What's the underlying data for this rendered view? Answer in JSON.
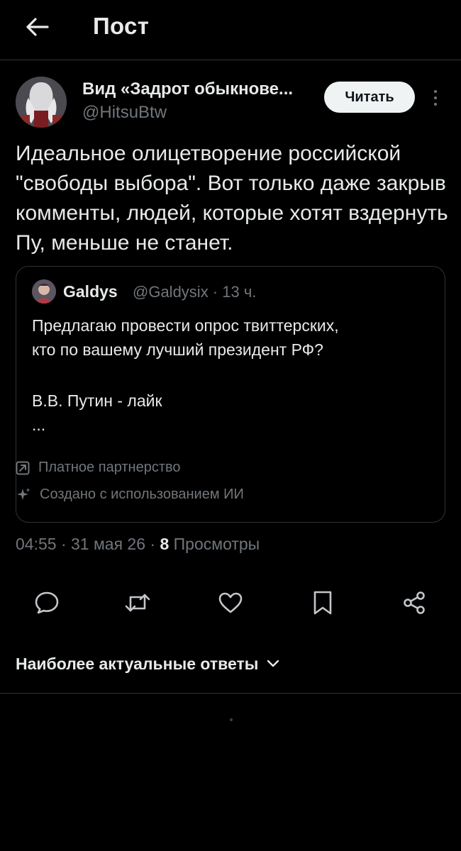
{
  "header": {
    "title": "Пост",
    "back_icon": "arrow-left-icon"
  },
  "post": {
    "author_name": "Вид «Задрот обыкнове...",
    "author_handle": "@HitsuBtw",
    "follow_label": "Читать",
    "text": "Идеальное олицетворение российской \"свободы выбора\". Вот только даже закрыв комменты, людей, которые хотят вздернуть Пу, меньше не станет.",
    "quote": {
      "author_name": "Galdys",
      "meta": "@Galdysix · 13 ч.",
      "lines": [
        "Предлагаю провести опрос твиттерских,",
        "кто по вашему лучший президент РФ?",
        "",
        "В.В. Путин - лайк",
        "..."
      ],
      "badges": {
        "paid": "Платное партнерство",
        "ai": "Создано с использованием ИИ"
      }
    },
    "timestamp": "04:55 · 31 мая 26 · ",
    "views_count": "8",
    "views_label": "Просмотры"
  },
  "actions": {
    "icons": [
      "reply-icon",
      "retweet-icon",
      "like-icon",
      "bookmark-icon",
      "share-icon"
    ]
  },
  "replies": {
    "sort_label": "Наиболее актуальные ответы"
  },
  "colors": {
    "background": "#000000",
    "text_primary": "#e7e9ea",
    "text_secondary": "#71767b",
    "border": "#2f3336",
    "button_bg": "#eff3f4"
  }
}
